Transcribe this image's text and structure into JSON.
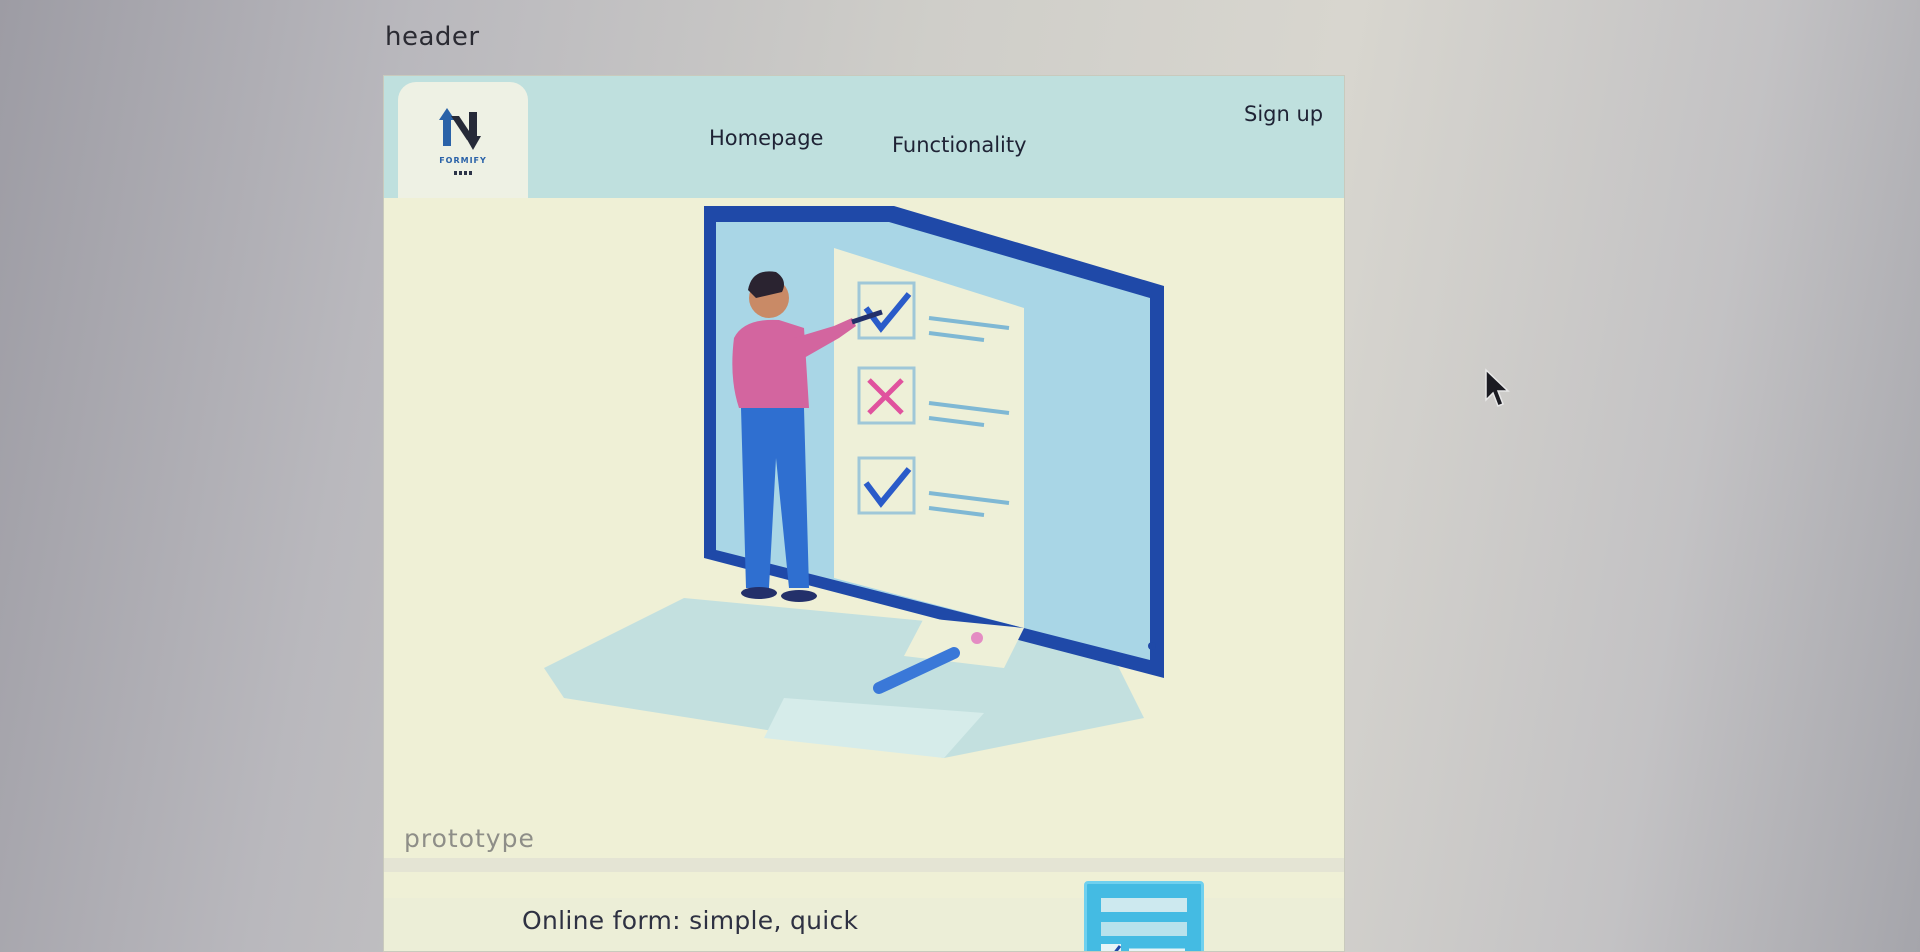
{
  "page": {
    "label": "header"
  },
  "navbar": {
    "logo_text": "FORMIFY",
    "links": [
      {
        "label": "Homepage"
      },
      {
        "label": "Functionality"
      }
    ],
    "signup_label": "Sign up"
  },
  "hero": {
    "caption": "prototype"
  },
  "section": {
    "subtitle": "Online form: simple, quick"
  },
  "icons": {
    "logo": "formify-logo-icon",
    "illustration": "form-checklist-illustration",
    "form": "form-checkbox-icon",
    "cursor": "mouse-pointer-icon"
  },
  "colors": {
    "navbar_bg": "#bfe0de",
    "hero_bg": "#eff0d6",
    "accent_blue": "#1f49a8",
    "check_blue": "#2a5bc9",
    "cross_pink": "#e0529e",
    "form_icon": "#44bbe3"
  }
}
